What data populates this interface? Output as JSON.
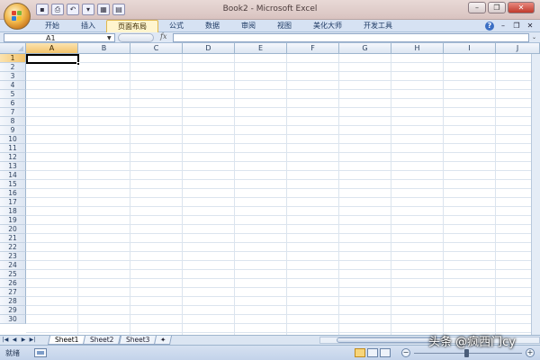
{
  "window": {
    "title": "Book2 - Microsoft Excel",
    "buttons": {
      "minimize": "–",
      "restore": "❐",
      "close": "✕"
    }
  },
  "quick_access": {
    "items": [
      {
        "icon": "save-icon",
        "glyph": "▪"
      },
      {
        "icon": "print-icon",
        "glyph": "⎙"
      },
      {
        "icon": "undo-icon",
        "glyph": "↶"
      },
      {
        "icon": "dropdown-icon",
        "glyph": "▾"
      },
      {
        "icon": "table-icon",
        "glyph": "▦"
      },
      {
        "icon": "preview-icon",
        "glyph": "▤"
      }
    ]
  },
  "ribbon": {
    "tabs": [
      "开始",
      "插入",
      "页面布局",
      "公式",
      "数据",
      "审阅",
      "视图",
      "美化大师",
      "开发工具"
    ],
    "active_tab": "页面布局",
    "help": "?",
    "min": "–",
    "restore": "❐",
    "close": "✕"
  },
  "formula_bar": {
    "name_box": "A1",
    "fx": "fx",
    "value": ""
  },
  "grid": {
    "columns": [
      "A",
      "B",
      "C",
      "D",
      "E",
      "F",
      "G",
      "H",
      "I",
      "J"
    ],
    "rows": [
      "1",
      "2",
      "3",
      "4",
      "5",
      "6",
      "7",
      "8",
      "9",
      "10",
      "11",
      "12",
      "13",
      "14",
      "15",
      "16",
      "17",
      "18",
      "19",
      "20",
      "21",
      "22",
      "23",
      "24",
      "25",
      "26",
      "27",
      "28",
      "29",
      "30"
    ],
    "selected_cell": "A1"
  },
  "sheets": {
    "nav": [
      "|◀",
      "◀",
      "▶",
      "▶|"
    ],
    "tabs": [
      "Sheet1",
      "Sheet2",
      "Sheet3"
    ],
    "active": "Sheet1",
    "new_tab_glyph": "✦"
  },
  "status": {
    "text": "就绪"
  },
  "watermark": "头条 @疯西门cy",
  "colors": {
    "selected_header": "#f3c36b",
    "ribbon_bg": "#d6e2f3",
    "title_bg": "#d9c3c0"
  }
}
